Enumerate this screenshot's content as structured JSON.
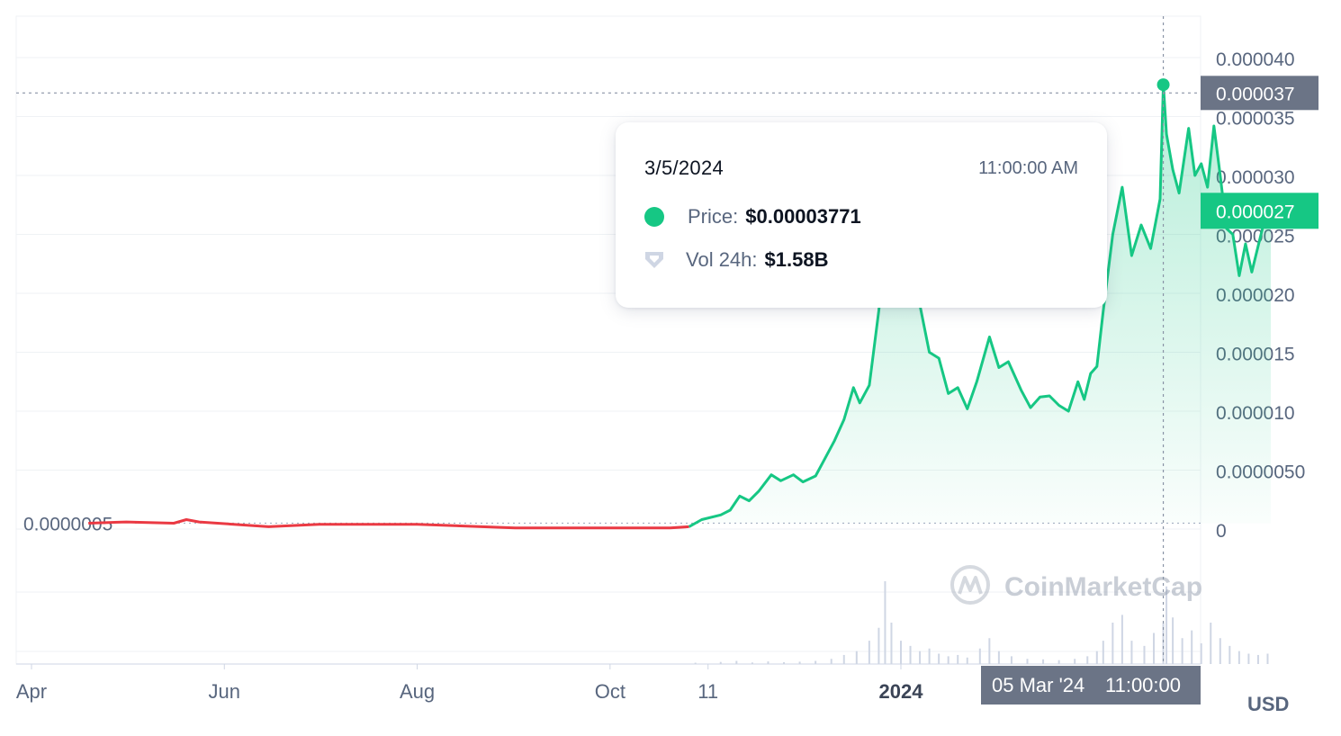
{
  "currency_label": "USD",
  "tooltip": {
    "date": "3/5/2024",
    "time": "11:00:00 AM",
    "price_label": "Price:",
    "price_value": "$0.00003771",
    "vol_label": "Vol 24h:",
    "vol_value": "$1.58B"
  },
  "crosshair": {
    "price_tag": "0.000037",
    "date_tag": "05 Mar '24",
    "time_tag": "11:00:00"
  },
  "current_price_tag": "0.000027",
  "baseline_label": "0.0000005",
  "watermark": "CoinMarketCap",
  "colors": {
    "up": "#16c784",
    "down": "#ea3943",
    "axis_text": "#58667e",
    "tag_gray": "#6b7486",
    "grid": "#eff2f5"
  },
  "chart_data": {
    "type": "line",
    "ylim": [
      0,
      4e-05
    ],
    "y_ticks": [
      "0",
      "0.0000050",
      "0.000010",
      "0.000015",
      "0.000020",
      "0.000025",
      "0.000030",
      "0.000035",
      "0.000040"
    ],
    "y_tick_values": [
      0,
      5e-06,
      1e-05,
      1.5e-05,
      2e-05,
      2.5e-05,
      3e-05,
      3.5e-05,
      4e-05
    ],
    "x_ticks": [
      "Apr",
      "Jun",
      "Aug",
      "Oct",
      "11",
      "2024"
    ],
    "x_tick_dates": [
      "2023-04-01",
      "2023-06-01",
      "2023-08-01",
      "2023-10-01",
      "2023-11-01",
      "2024-01-01"
    ],
    "baseline_value": 5e-07,
    "series": [
      {
        "values": [
          [
            "2023-04-19",
            5e-07
          ],
          [
            "2023-05-01",
            6e-07
          ],
          [
            "2023-05-16",
            5e-07
          ],
          [
            "2023-05-20",
            8e-07
          ],
          [
            "2023-05-24",
            6e-07
          ],
          [
            "2023-06-15",
            2e-07
          ],
          [
            "2023-07-01",
            4e-07
          ],
          [
            "2023-08-01",
            4e-07
          ],
          [
            "2023-09-01",
            1e-07
          ],
          [
            "2023-10-01",
            1e-07
          ],
          [
            "2023-10-20",
            1e-07
          ],
          [
            "2023-10-26",
            2e-07
          ],
          [
            "2023-10-30",
            8e-07
          ],
          [
            "2023-11-05",
            1.2e-06
          ],
          [
            "2023-11-08",
            1.6e-06
          ],
          [
            "2023-11-11",
            2.8e-06
          ],
          [
            "2023-11-14",
            2.4e-06
          ],
          [
            "2023-11-17",
            3.2e-06
          ],
          [
            "2023-11-21",
            4.6e-06
          ],
          [
            "2023-11-24",
            4.1e-06
          ],
          [
            "2023-11-28",
            4.6e-06
          ],
          [
            "2023-12-01",
            4e-06
          ],
          [
            "2023-12-05",
            4.5e-06
          ],
          [
            "2023-12-08",
            6e-06
          ],
          [
            "2023-12-11",
            7.5e-06
          ],
          [
            "2023-12-14",
            9.3e-06
          ],
          [
            "2023-12-17",
            1.2e-05
          ],
          [
            "2023-12-19",
            1.07e-05
          ],
          [
            "2023-12-22",
            1.22e-05
          ],
          [
            "2023-12-25",
            1.85e-05
          ],
          [
            "2023-12-27",
            2.4e-05
          ],
          [
            "2023-12-29",
            2.05e-05
          ],
          [
            "2024-01-02",
            1.92e-05
          ],
          [
            "2024-01-04",
            2.25e-05
          ],
          [
            "2024-01-07",
            1.9e-05
          ],
          [
            "2024-01-10",
            1.5e-05
          ],
          [
            "2024-01-13",
            1.45e-05
          ],
          [
            "2024-01-16",
            1.15e-05
          ],
          [
            "2024-01-19",
            1.2e-05
          ],
          [
            "2024-01-22",
            1.02e-05
          ],
          [
            "2024-01-25",
            1.25e-05
          ],
          [
            "2024-01-29",
            1.63e-05
          ],
          [
            "2024-02-01",
            1.37e-05
          ],
          [
            "2024-02-04",
            1.42e-05
          ],
          [
            "2024-02-08",
            1.18e-05
          ],
          [
            "2024-02-11",
            1.03e-05
          ],
          [
            "2024-02-14",
            1.12e-05
          ],
          [
            "2024-02-17",
            1.13e-05
          ],
          [
            "2024-02-20",
            1.05e-05
          ],
          [
            "2024-02-23",
            1e-05
          ],
          [
            "2024-02-26",
            1.25e-05
          ],
          [
            "2024-02-28",
            1.1e-05
          ],
          [
            "2024-03-01",
            1.32e-05
          ],
          [
            "2024-03-03",
            1.38e-05
          ],
          [
            "2024-03-05",
            1.85e-05
          ],
          [
            "2024-03-08",
            2.5e-05
          ],
          [
            "2024-03-11",
            2.9e-05
          ],
          [
            "2024-03-14",
            2.32e-05
          ],
          [
            "2024-03-17",
            2.58e-05
          ],
          [
            "2024-03-20",
            2.38e-05
          ],
          [
            "2024-03-23",
            2.8e-05
          ],
          [
            "2024-03-24",
            3.77e-05
          ],
          [
            "2024-03-25",
            3.35e-05
          ],
          [
            "2024-03-27",
            3.05e-05
          ],
          [
            "2024-03-29",
            2.85e-05
          ],
          [
            "2024-04-01",
            3.4e-05
          ],
          [
            "2024-04-03",
            3e-05
          ],
          [
            "2024-04-05",
            3.1e-05
          ],
          [
            "2024-04-07",
            2.9e-05
          ],
          [
            "2024-04-09",
            3.42e-05
          ],
          [
            "2024-04-11",
            3e-05
          ],
          [
            "2024-04-13",
            2.55e-05
          ],
          [
            "2024-04-15",
            2.5e-05
          ],
          [
            "2024-04-17",
            2.15e-05
          ],
          [
            "2024-04-19",
            2.42e-05
          ],
          [
            "2024-04-21",
            2.18e-05
          ],
          [
            "2024-04-23",
            2.4e-05
          ],
          [
            "2024-04-25",
            2.62e-05
          ],
          [
            "2024-04-27",
            2.68e-05
          ]
        ]
      }
    ],
    "crosshair_value": 3.7e-05,
    "current_value": 2.7e-05,
    "volume_usd_billions": [
      [
        "2023-10-28",
        0.05
      ],
      [
        "2023-11-05",
        0.08
      ],
      [
        "2023-11-10",
        0.12
      ],
      [
        "2023-11-15",
        0.06
      ],
      [
        "2023-11-20",
        0.1
      ],
      [
        "2023-11-25",
        0.07
      ],
      [
        "2023-11-30",
        0.09
      ],
      [
        "2023-12-05",
        0.12
      ],
      [
        "2023-12-10",
        0.2
      ],
      [
        "2023-12-14",
        0.35
      ],
      [
        "2023-12-18",
        0.5
      ],
      [
        "2023-12-22",
        0.9
      ],
      [
        "2023-12-25",
        1.4
      ],
      [
        "2023-12-27",
        3.2
      ],
      [
        "2023-12-29",
        1.6
      ],
      [
        "2024-01-01",
        0.9
      ],
      [
        "2024-01-04",
        0.7
      ],
      [
        "2024-01-07",
        0.5
      ],
      [
        "2024-01-10",
        0.6
      ],
      [
        "2024-01-13",
        0.4
      ],
      [
        "2024-01-16",
        0.3
      ],
      [
        "2024-01-19",
        0.35
      ],
      [
        "2024-01-22",
        0.25
      ],
      [
        "2024-01-26",
        0.6
      ],
      [
        "2024-01-29",
        1.0
      ],
      [
        "2024-02-01",
        0.5
      ],
      [
        "2024-02-05",
        0.3
      ],
      [
        "2024-02-10",
        0.2
      ],
      [
        "2024-02-15",
        0.18
      ],
      [
        "2024-02-20",
        0.15
      ],
      [
        "2024-02-25",
        0.2
      ],
      [
        "2024-02-29",
        0.3
      ],
      [
        "2024-03-03",
        0.5
      ],
      [
        "2024-03-05",
        0.9
      ],
      [
        "2024-03-08",
        1.6
      ],
      [
        "2024-03-11",
        1.9
      ],
      [
        "2024-03-14",
        0.9
      ],
      [
        "2024-03-18",
        0.7
      ],
      [
        "2024-03-21",
        1.2
      ],
      [
        "2024-03-24",
        1.58
      ],
      [
        "2024-03-25",
        3.0
      ],
      [
        "2024-03-27",
        1.8
      ],
      [
        "2024-03-30",
        1.0
      ],
      [
        "2024-04-02",
        1.3
      ],
      [
        "2024-04-05",
        0.8
      ],
      [
        "2024-04-08",
        1.6
      ],
      [
        "2024-04-11",
        1.0
      ],
      [
        "2024-04-14",
        0.7
      ],
      [
        "2024-04-17",
        0.5
      ],
      [
        "2024-04-20",
        0.4
      ],
      [
        "2024-04-23",
        0.35
      ],
      [
        "2024-04-26",
        0.4
      ]
    ],
    "grid": true
  }
}
